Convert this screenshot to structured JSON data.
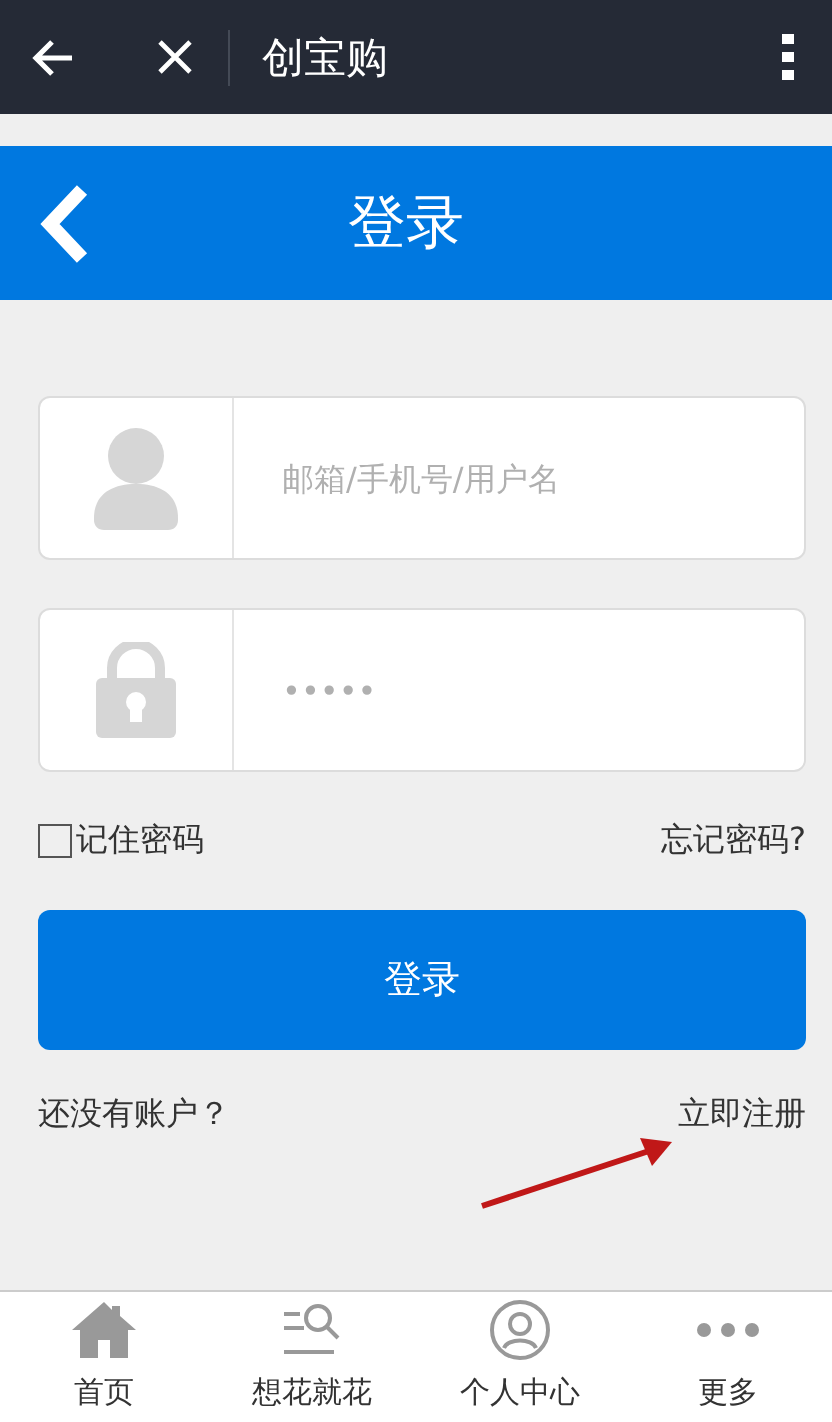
{
  "top_bar": {
    "title": "创宝购"
  },
  "header": {
    "title": "登录"
  },
  "fields": [
    {
      "kind": "user",
      "placeholder": "邮箱/手机号/用户名"
    },
    {
      "kind": "lock",
      "placeholder": "•••••"
    }
  ],
  "remember": {
    "label": "记住密码",
    "checked": false
  },
  "forgot_link": "忘记密码?",
  "login_button": "登录",
  "register": {
    "prompt": "还没有账户？",
    "link": "立即注册"
  },
  "tab_bar": [
    {
      "kind": "home",
      "label": "首页"
    },
    {
      "kind": "search",
      "label": "想花就花"
    },
    {
      "kind": "person",
      "label": "个人中心"
    },
    {
      "kind": "more",
      "label": "更多"
    }
  ]
}
